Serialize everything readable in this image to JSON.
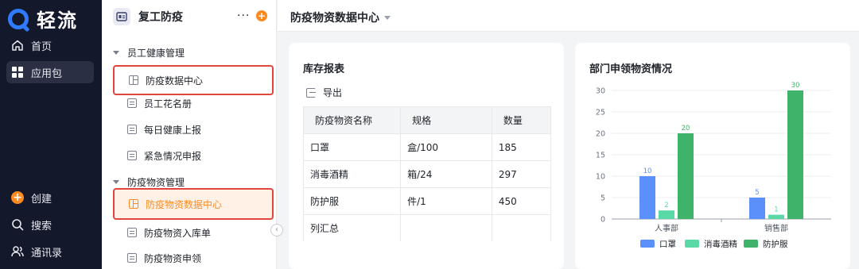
{
  "nav": {
    "brand": "轻流",
    "items": [
      {
        "label": "首页",
        "icon": "home-icon"
      },
      {
        "label": "应用包",
        "icon": "grid-icon"
      }
    ],
    "bottom_items": [
      {
        "label": "创建",
        "icon": "plus-icon"
      },
      {
        "label": "搜索",
        "icon": "search-icon"
      },
      {
        "label": "通讯录",
        "icon": "contacts-icon"
      }
    ]
  },
  "app": {
    "title": "复工防疫",
    "more": "···",
    "groups": [
      {
        "label": "员工健康管理",
        "pages": [
          "防疫数据中心",
          "员工花名册",
          "每日健康上报",
          "紧急情况申报"
        ]
      },
      {
        "label": "防疫物资管理",
        "pages": [
          "防疫物资数据中心",
          "防疫物资入库单",
          "防疫物资申领"
        ]
      }
    ]
  },
  "header": {
    "title": "防疫物资数据中心"
  },
  "stock_report": {
    "title": "库存报表",
    "export_label": "导出",
    "columns": [
      "防疫物资名称",
      "规格",
      "数量"
    ],
    "rows": [
      [
        "口罩",
        "盒/100",
        "185"
      ],
      [
        "消毒酒精",
        "箱/24",
        "297"
      ],
      [
        "防护服",
        "件/1",
        "450"
      ],
      [
        "列汇总",
        "",
        ""
      ]
    ]
  },
  "dept_chart": {
    "title": "部门申领物资情况"
  },
  "chart_data": {
    "type": "bar",
    "title": "部门申领物资情况",
    "categories": [
      "人事部",
      "销售部"
    ],
    "series": [
      {
        "name": "口罩",
        "values": [
          10,
          5
        ],
        "color": "#5b8ff9"
      },
      {
        "name": "消毒酒精",
        "values": [
          2,
          1
        ],
        "color": "#5ad8a6"
      },
      {
        "name": "防护服",
        "values": [
          20,
          30
        ],
        "color": "#3fb36a"
      }
    ],
    "ylim": [
      0,
      30
    ],
    "yticks": [
      0,
      5,
      10,
      15,
      20,
      25,
      30
    ],
    "grid": true,
    "legend": "bottom"
  }
}
